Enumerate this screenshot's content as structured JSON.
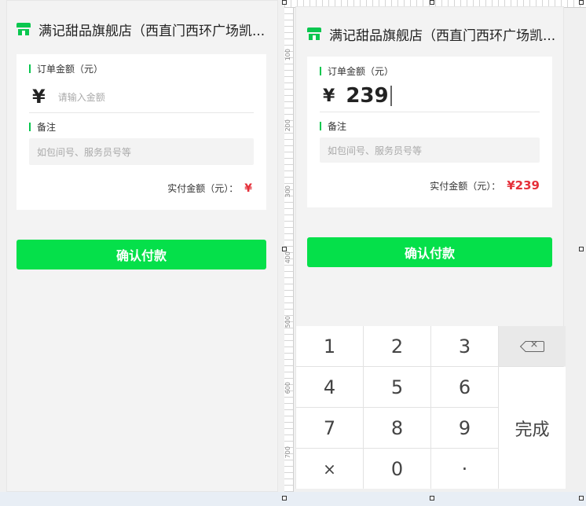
{
  "store": {
    "name": "满记甜品旗舰店（西直门西环广场凯..."
  },
  "order": {
    "amount_label": "订单金额（元）",
    "currency": "¥",
    "amount_placeholder": "请输入金额",
    "note_label": "备注",
    "note_placeholder": "如包间号、服务员号等",
    "paid_label": "实付金额（元）：",
    "confirm_label": "确认付款"
  },
  "left_state": {
    "paid_value": "¥"
  },
  "right_state": {
    "amount_value": "239",
    "paid_value": "¥239"
  },
  "keypad": {
    "keys": [
      "1",
      "2",
      "3",
      "4",
      "5",
      "6",
      "7",
      "8",
      "9",
      "×",
      "0",
      "·"
    ],
    "done_label": "完成",
    "delete_icon": "backspace-icon"
  },
  "ruler": {
    "marks": [
      "100",
      "200",
      "300",
      "400",
      "500",
      "600",
      "700"
    ]
  },
  "colors": {
    "accent": "#05e04a",
    "price": "#e5303a"
  }
}
